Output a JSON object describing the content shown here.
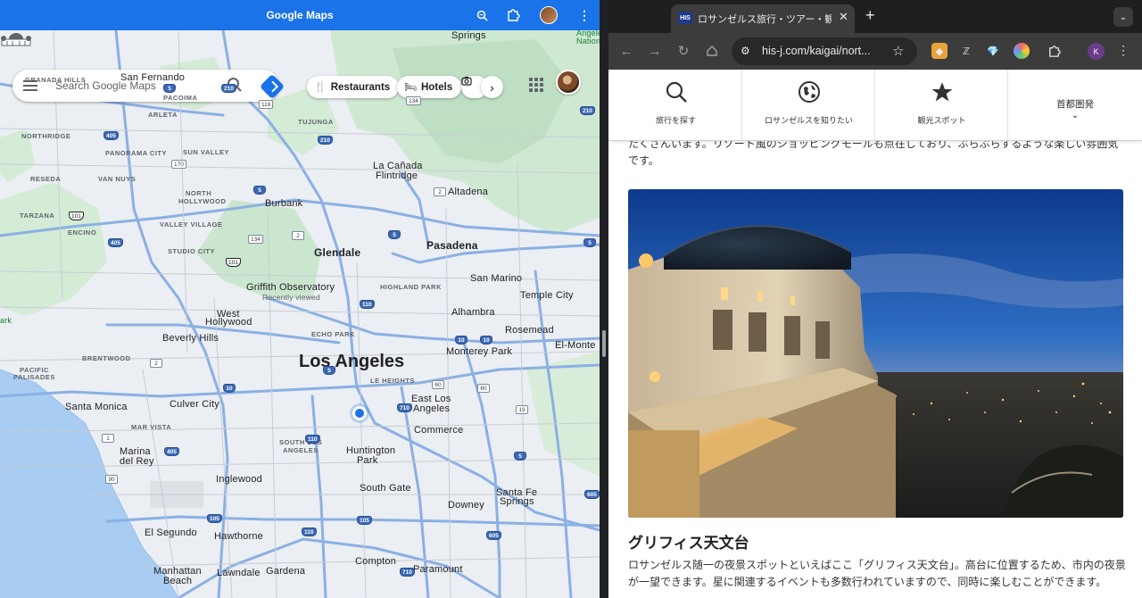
{
  "maps": {
    "window_title": "Google Maps",
    "search_placeholder": "Search Google Maps",
    "chips": [
      {
        "label": "Restaurants",
        "icon": "fork-knife-icon"
      },
      {
        "label": "Hotels",
        "icon": "bed-icon"
      }
    ],
    "labels": {
      "los_angeles": "Los Angeles",
      "glendale": "Glendale",
      "pasadena": "Pasadena",
      "burbank": "Burbank",
      "griffith": "Griffith Observatory",
      "recently_viewed": "Recently viewed",
      "beverly_hills": "Beverly Hills",
      "west_hollywood_1": "West",
      "west_hollywood_2": "Hollywood",
      "santa_monica": "Santa Monica",
      "culver_city": "Culver City",
      "inglewood": "Inglewood",
      "hawthorne": "Hawthorne",
      "el_segundo": "El Segundo",
      "manhattan_beach_1": "Manhattan",
      "manhattan_beach_2": "Beach",
      "lawndale": "Lawndale",
      "gardena": "Gardena",
      "compton": "Compton",
      "paramount": "Paramount",
      "downey": "Downey",
      "south_gate": "South Gate",
      "huntington_park_1": "Huntington",
      "huntington_park_2": "Park",
      "commerce": "Commerce",
      "east_la_1": "East Los",
      "east_la_2": "Angeles",
      "monterey_park": "Monterey Park",
      "alhambra": "Alhambra",
      "rosemead": "Rosemead",
      "el_monte": "El-Monte",
      "temple_city": "Temple City",
      "san_marino": "San Marino",
      "altadena": "Altadena",
      "la_canada_1": "La Cañada",
      "la_canada_2": "Flintridge",
      "santa_fe_1": "Santa Fe",
      "santa_fe_2": "Springs",
      "marina_1": "Marina",
      "marina_2": "del Rey",
      "san_fernando": "San Fernando",
      "springs": "Springs",
      "angeles_1": "Angele",
      "angeles_2": "National",
      "ark": "ark",
      "granada_hills": "GRANADA HILLS",
      "pacoima": "PACOIMA",
      "sylmar_arleta": "ARLETA",
      "tujunga": "TUJUNGA",
      "northridge": "NORTHRIDGE",
      "panorama_city": "PANORAMA CITY",
      "sun_valley": "SUN VALLEY",
      "reseda": "RESEDA",
      "van_nuys": "VAN NUYS",
      "north_1": "NORTH",
      "north_2": "HOLLYWOOD",
      "tarzana": "TARZANA",
      "valley_village": "VALLEY VILLAGE",
      "encino": "ENCINO",
      "studio_city": "STUDIO CITY",
      "highland_park": "HIGHLAND PARK",
      "echo_park": "ECHO PARK",
      "boyle_heights": "LE HEIGHTS",
      "brentwood": "BRENTWOOD",
      "pacific_1": "PACIFIC",
      "pacific_2": "PALISADES",
      "mar_vista": "MAR VISTA",
      "south_la_1": "SOUTH LOS",
      "south_la_2": "ANGELES"
    },
    "shields": [
      "210",
      "5",
      "118",
      "405",
      "170",
      "5",
      "134",
      "2",
      "101",
      "101",
      "405",
      "110",
      "10",
      "10",
      "10",
      "60",
      "60",
      "405",
      "105",
      "105",
      "110",
      "605",
      "5",
      "710",
      "19",
      "710",
      "1",
      "90",
      "2",
      "5",
      "5",
      "110",
      "605",
      "5",
      "134",
      "210",
      "210",
      "2"
    ]
  },
  "browser": {
    "tab_title": "ロサンゼルス旅行・ツアー・観光",
    "tab_favicon": "HIS",
    "url": "his-j.com/kaigai/nort...",
    "profile_initial": "K"
  },
  "site": {
    "nav": [
      {
        "label": "旅行を探す",
        "icon": "search-icon"
      },
      {
        "label": "ロサンゼルスを知りたい",
        "icon": "globe-icon"
      },
      {
        "label": "観光スポット",
        "icon": "star-icon"
      },
      {
        "label": "首都圏発",
        "icon": "chevron-down-icon"
      }
    ],
    "top_paragraph": "たくさんいます。リゾート風のショッピングモールも点在しており、ぶらぶらするような楽しい雰囲気です。",
    "heading": "グリフィス天文台",
    "paragraph": "ロサンゼルス随一の夜景スポットといえばここ「グリフィス天文台」。高台に位置するため、市内の夜景が一望できます。星に関連するイベントも多数行われていますので、同時に楽しむことができます。"
  }
}
